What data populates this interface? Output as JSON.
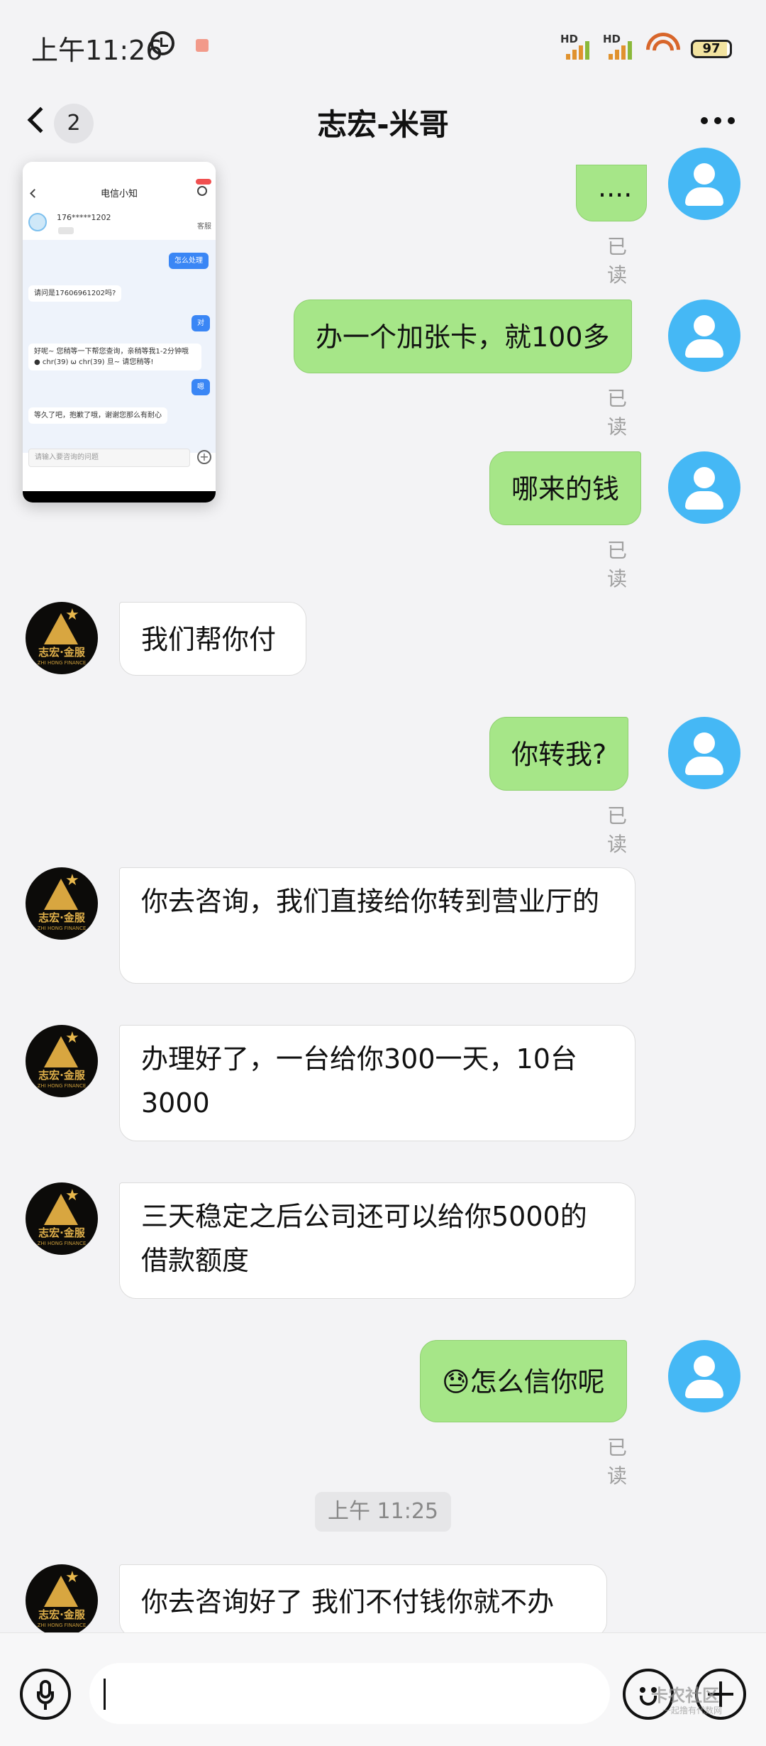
{
  "status_bar": {
    "time": "上午11:26",
    "signal1": "HD",
    "signal2": "HD",
    "battery": "97"
  },
  "header": {
    "back_count": "2",
    "title": "志宏-米哥"
  },
  "messages": [
    {
      "side": "me",
      "text": "....",
      "status": "已读"
    },
    {
      "side": "me",
      "text": "办一个加张卡，就100多",
      "status": "已读"
    },
    {
      "side": "me",
      "text": "哪来的钱",
      "status": "已读"
    },
    {
      "side": "bot",
      "text": "我们帮你付"
    },
    {
      "side": "me",
      "text": "你转我?",
      "status": "已读"
    },
    {
      "side": "bot",
      "text": "你去咨询，我们直接给你转到营业厅的"
    },
    {
      "side": "bot",
      "text": "办理好了，一台给你300一天，10台3000"
    },
    {
      "side": "bot",
      "text": "三天稳定之后公司还可以给你5000的借款额度"
    },
    {
      "side": "me",
      "text": "😓怎么信你呢",
      "status": "已读"
    },
    {
      "side": "bot",
      "text": "你去咨询好了 我们不付钱你就不办"
    }
  ],
  "time_separator": "上午 11:25",
  "bot_avatar": {
    "logo_text": "志宏·金服",
    "logo_sub": "ZHI HONG FINANCE"
  },
  "preview": {
    "title": "电信小知",
    "phone": "176*****1202",
    "service": "客服",
    "messages": [
      {
        "side": "me",
        "text": "怎么处理"
      },
      {
        "side": "bot",
        "text": "请问是17606961202吗?"
      },
      {
        "side": "me",
        "text": "对"
      },
      {
        "side": "bot",
        "text": "好呢~ 您稍等一下帮您查询，亲稍等我1-2分钟哦 ● chr(39) ω chr(39) 旦~ 请您稍等!"
      },
      {
        "side": "me",
        "text": "嗯"
      },
      {
        "side": "bot",
        "text": "等久了吧，抱歉了哦，谢谢您那么有耐心"
      }
    ],
    "input_placeholder": "请输入要咨询的问题"
  },
  "input_bar": {
    "icons": [
      "microphone-icon",
      "emoji-icon",
      "plus-icon"
    ],
    "watermark": "卡农社区",
    "watermark_sub": "一起撸有代数网"
  }
}
